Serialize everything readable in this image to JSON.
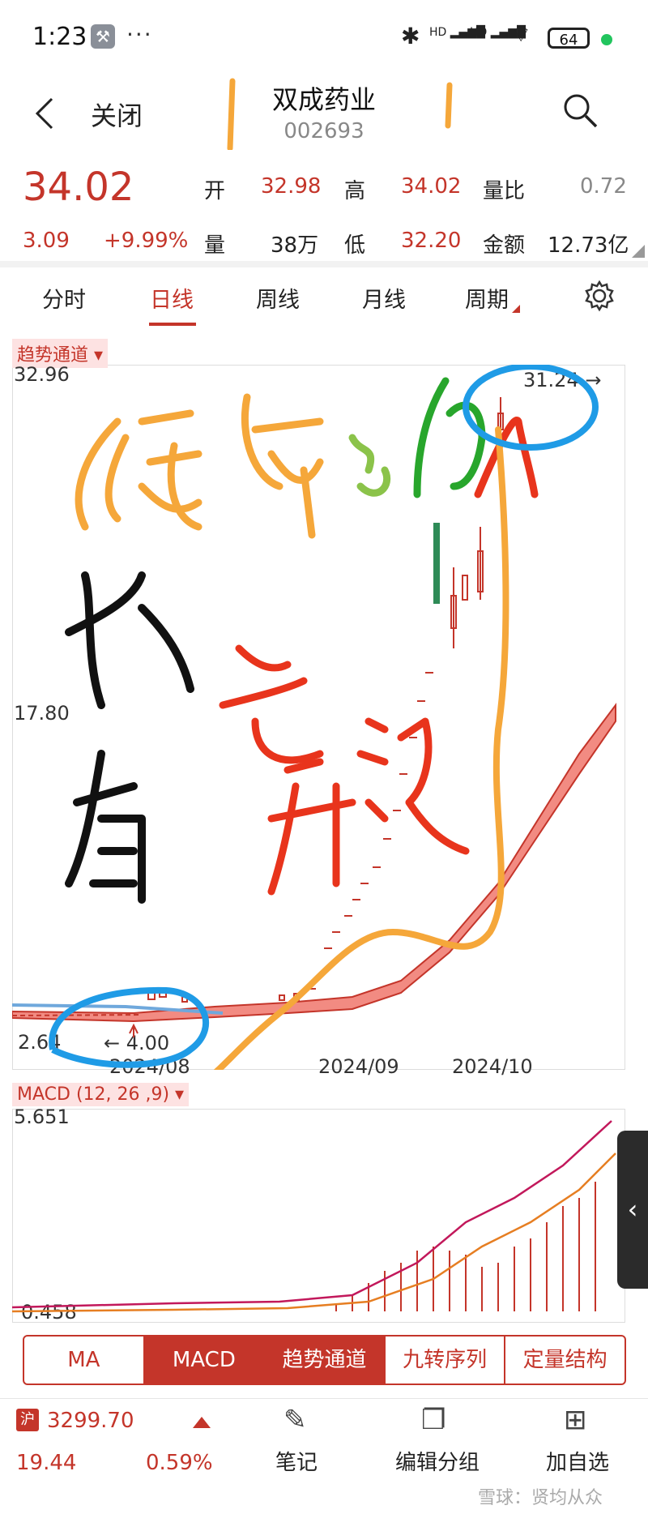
{
  "status_bar": {
    "time": "1:23",
    "wrench": "wrench-icon",
    "dots": "···",
    "bluetooth": "✱",
    "sim1": "HD",
    "sim2": "HD",
    "battery": "64"
  },
  "header": {
    "close_label": "关闭",
    "stock_name": "双成药业",
    "stock_code": "002693"
  },
  "quote": {
    "price": "34.02",
    "change": "3.09",
    "change_pct": "+9.99%",
    "open_label": "开",
    "open": "32.98",
    "high_label": "高",
    "high": "34.02",
    "ratio_label": "量比",
    "ratio": "0.72",
    "volume_label": "量",
    "volume": "38万",
    "low_label": "低",
    "low": "32.20",
    "amount_label": "金额",
    "amount": "12.73亿"
  },
  "tabs": [
    "分时",
    "日线",
    "周线",
    "月线",
    "周期"
  ],
  "active_tab": 1,
  "main_chart": {
    "indicator_label": "趋势通道 ▾",
    "y_top": "32.96",
    "y_mid": "17.80",
    "y_bottom": "2.64",
    "max_marker": "31.24 →",
    "min_marker": "← 4.00",
    "x_labels": [
      "2024/08",
      "2024/09",
      "2024/10"
    ]
  },
  "macd_chart": {
    "indicator_label": "MACD (12, 26 ,9) ▾",
    "y_top": "5.651",
    "y_bottom": "0.458"
  },
  "indicators": [
    "MA",
    "MACD",
    "趋势通道",
    "九转序列",
    "定量结构"
  ],
  "active_indicators": [
    1,
    2
  ],
  "bottom_bar": {
    "index_badge": "沪",
    "index_value": "3299.70",
    "index_change": "19.44",
    "index_pct": "0.59%",
    "notes_label": "笔记",
    "edit_group_label": "编辑分组",
    "add_watch_label": "加自选"
  },
  "watermark": "雪球：贤均从众",
  "handwriting": {
    "line1": "缠绵之后",
    "line2": "主升浪",
    "line3": "必有"
  },
  "colors": {
    "accent": "#c4352a",
    "handwriting_orange": "#f5a73a",
    "handwriting_red": "#e8341c",
    "handwriting_blue": "#1f9be6",
    "handwriting_green": "#28a62c"
  }
}
